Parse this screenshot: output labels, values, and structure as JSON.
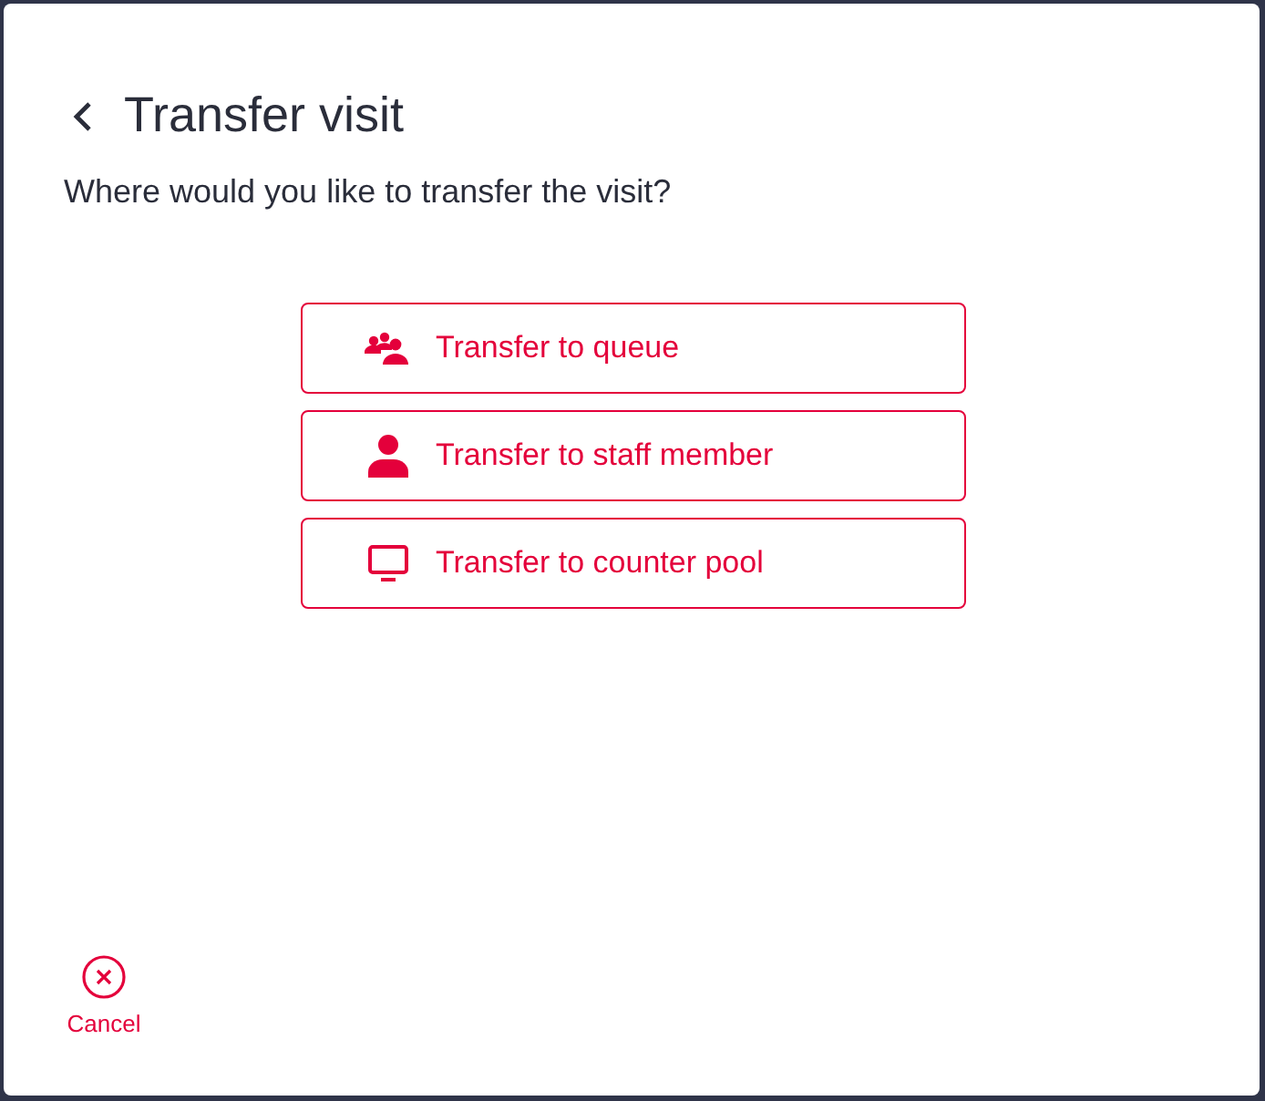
{
  "dialog": {
    "title": "Transfer visit",
    "question": "Where would you like to transfer the visit?"
  },
  "options": [
    {
      "label": "Transfer to queue",
      "kind": "group"
    },
    {
      "label": "Transfer to staff member",
      "kind": "person"
    },
    {
      "label": "Transfer to counter pool",
      "kind": "monitor"
    }
  ],
  "cancel": {
    "label": "Cancel"
  }
}
